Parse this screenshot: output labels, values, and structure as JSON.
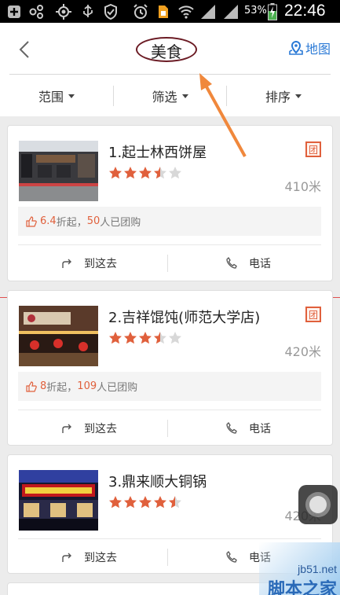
{
  "status_bar": {
    "battery_percent": "53%",
    "time": "22:46"
  },
  "header": {
    "title": "美食",
    "map_label": "地图"
  },
  "filters": [
    {
      "label": "范围"
    },
    {
      "label": "筛选"
    },
    {
      "label": "排序"
    }
  ],
  "colors": {
    "accent_orange": "#e0603c",
    "link_blue": "#2b7ad6",
    "star_filled": "#e0603c",
    "star_empty": "#d8d8d8",
    "annotation_oval": "#6b1b24",
    "annotation_arrow": "#f0883c"
  },
  "shops": [
    {
      "name": "1.起士林西饼屋",
      "rating": 3.5,
      "distance": "410米",
      "badge": "团",
      "promo_value": "6.4",
      "promo_mid": "折起，",
      "promo_count": "50",
      "promo_tail": "人已团购",
      "action_go": "到这去",
      "action_call": "电话"
    },
    {
      "name": "2.吉祥馄饨(师范大学店)",
      "rating": 3.5,
      "distance": "420米",
      "badge": "团",
      "promo_value": "8",
      "promo_mid": "折起，",
      "promo_count": "109",
      "promo_tail": "人已团购",
      "action_go": "到这去",
      "action_call": "电话"
    },
    {
      "name": "3.鼎来顺大铜锅",
      "rating": 4.5,
      "distance": "420米",
      "badge": "",
      "promo_value": "",
      "promo_mid": "",
      "promo_count": "",
      "promo_tail": "",
      "action_go": "到这去",
      "action_call": "电话"
    }
  ],
  "watermark": {
    "url": "jb51.net",
    "name": "脚本之家"
  }
}
